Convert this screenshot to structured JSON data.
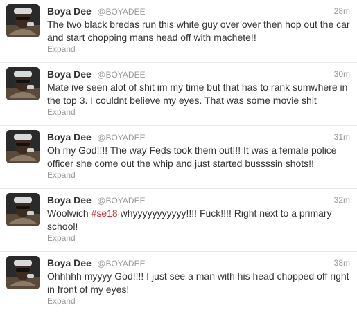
{
  "tweets": [
    {
      "fullname": "Boya Dee",
      "username": "@BOYADEE",
      "time": "28m",
      "text": "The two black bredas run this white guy over over then hop out the car and start chopping mans head off with machete!!",
      "expand": "Expand"
    },
    {
      "fullname": "Boya Dee",
      "username": "@BOYADEE",
      "time": "30m",
      "text": "Mate ive seen alot of shit im my time but that has to rank sumwhere in the top 3. I couldnt believe my eyes. That was some movie shit",
      "expand": "Expand"
    },
    {
      "fullname": "Boya Dee",
      "username": "@BOYADEE",
      "time": "31m",
      "text": "Oh my God!!!! The way Feds took them out!!! It was a female police officer she come out the whip and just started bussssin shots!!",
      "expand": "Expand"
    },
    {
      "fullname": "Boya Dee",
      "username": "@BOYADEE",
      "time": "32m",
      "text_before": "Woolwich ",
      "hashtag": "#se18",
      "text_after": " whyyyyyyyyyyy!!!! Fuck!!!! Right next to a primary school!",
      "expand": "Expand"
    },
    {
      "fullname": "Boya Dee",
      "username": "@BOYADEE",
      "time": "38m",
      "text": "Ohhhhh myyyy God!!!! I just see a man with his  head chopped off right in front of my eyes!",
      "expand": "Expand"
    }
  ],
  "colors": {
    "hashtag": "#cc3333",
    "meta": "#999999",
    "text": "#333333",
    "divider": "#e8e8e8"
  }
}
